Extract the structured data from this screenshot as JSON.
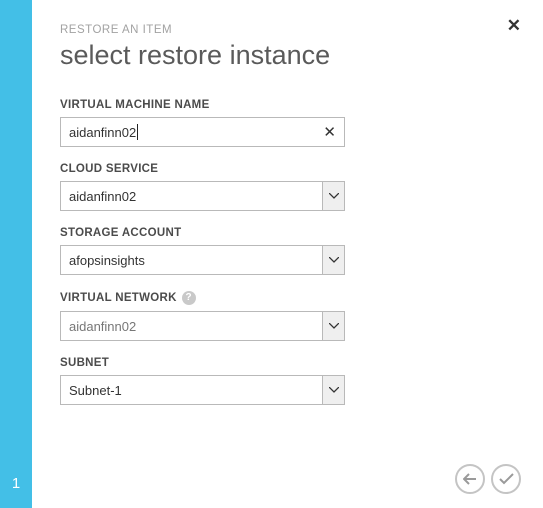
{
  "step_number": "1",
  "eyebrow": "RESTORE AN ITEM",
  "title": "select restore instance",
  "fields": {
    "vm_name": {
      "label": "VIRTUAL MACHINE NAME",
      "value": "aidanfinn02"
    },
    "cloud_service": {
      "label": "CLOUD SERVICE",
      "value": "aidanfinn02"
    },
    "storage_account": {
      "label": "STORAGE ACCOUNT",
      "value": "afopsinsights"
    },
    "virtual_network": {
      "label": "VIRTUAL NETWORK",
      "value": "aidanfinn02"
    },
    "subnet": {
      "label": "SUBNET",
      "value": "Subnet-1"
    }
  }
}
